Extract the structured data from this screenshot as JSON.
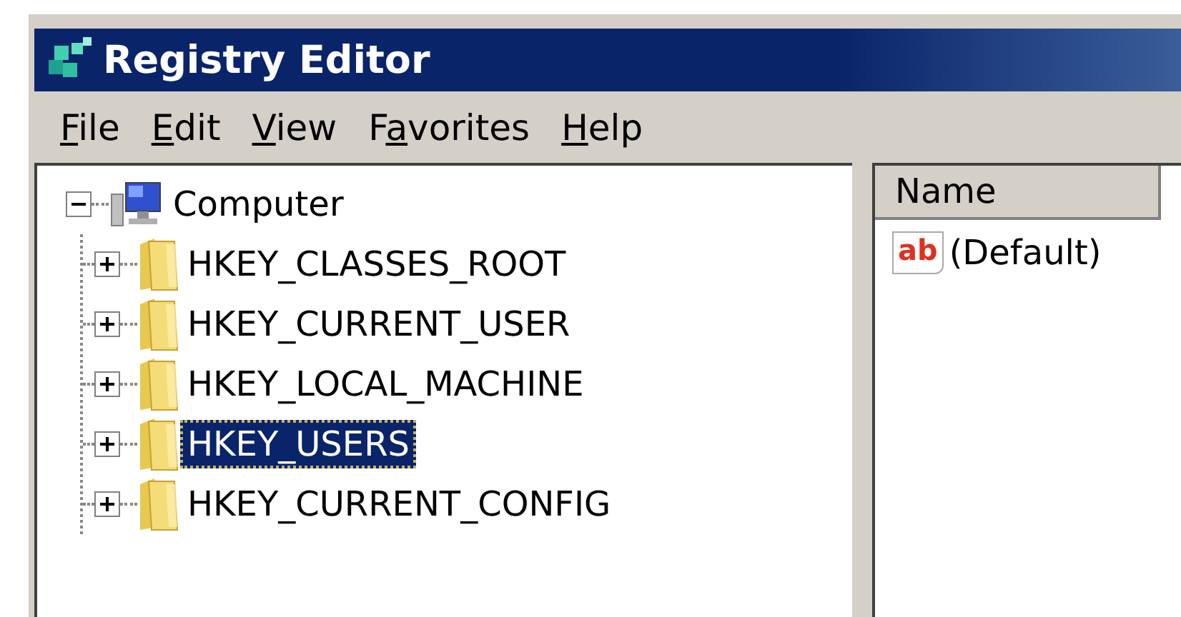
{
  "window": {
    "title": "Registry Editor"
  },
  "menu": [
    {
      "key": "F",
      "post": "ile"
    },
    {
      "key": "E",
      "post": "dit"
    },
    {
      "key": "V",
      "post": "iew"
    },
    {
      "pre": "F",
      "key": "a",
      "post": "vorites"
    },
    {
      "key": "H",
      "post": "elp"
    }
  ],
  "tree": {
    "label": "Computer",
    "expanded": true,
    "selected": false,
    "children": [
      {
        "label": "HKEY_CLASSES_ROOT",
        "expanded": false,
        "selected": false
      },
      {
        "label": "HKEY_CURRENT_USER",
        "expanded": false,
        "selected": false
      },
      {
        "label": "HKEY_LOCAL_MACHINE",
        "expanded": false,
        "selected": false
      },
      {
        "label": "HKEY_USERS",
        "expanded": false,
        "selected": true
      },
      {
        "label": "HKEY_CURRENT_CONFIG",
        "expanded": false,
        "selected": false
      }
    ]
  },
  "values": {
    "columns": [
      "Name"
    ],
    "rows": [
      {
        "type_glyph": "ab",
        "name": "(Default)"
      }
    ]
  }
}
